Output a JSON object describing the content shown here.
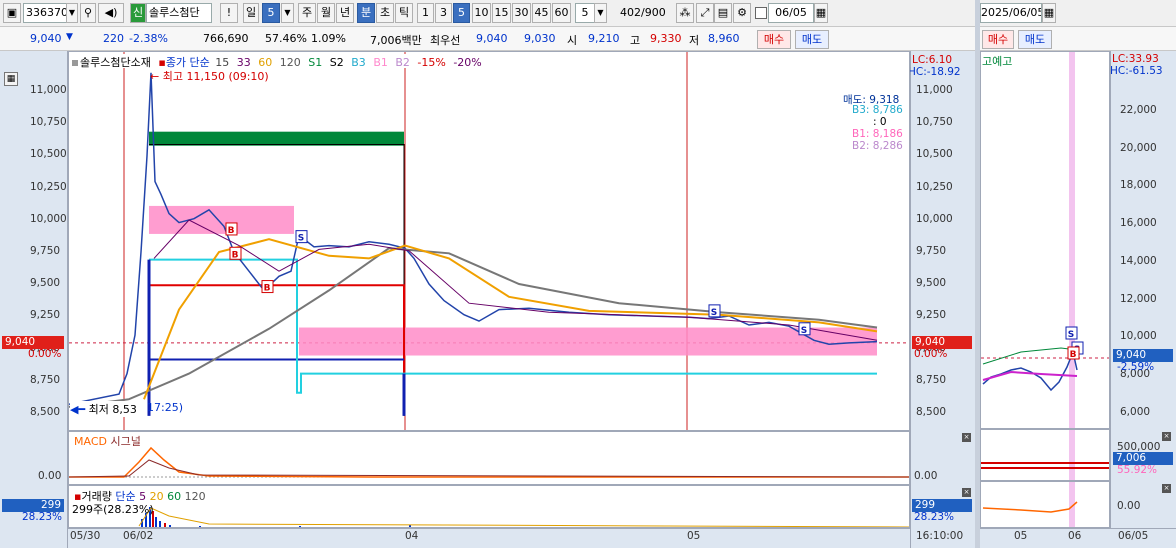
{
  "toolbar": {
    "code": "336370",
    "badge": "신",
    "name": "솔루스첨단",
    "warn": "!",
    "period": "일",
    "period_count": "5",
    "periods": [
      "주",
      "월",
      "년",
      "분",
      "초",
      "틱"
    ],
    "intervals": [
      "1",
      "3",
      "5",
      "10",
      "15",
      "30",
      "45",
      "60"
    ],
    "selected_interval": "5",
    "unit_value": "5",
    "count": "402",
    "count_total": "/900",
    "date": "06/05"
  },
  "quote": {
    "price": "9,040",
    "change": "220",
    "change_pct": "-2.38%",
    "volume": "766,690",
    "vol_ratio": "57.46%",
    "turnover_ratio": "1.09%",
    "amount": "7,006백만",
    "best_label": "최우선",
    "ask1": "9,040",
    "bid1": "9,030",
    "open_label": "시",
    "open": "9,210",
    "high_label": "고",
    "high": "9,330",
    "low_label": "저",
    "low": "8,960",
    "buy": "매수",
    "sell": "매도"
  },
  "main_chart": {
    "legend": {
      "name": "솔루스첨단소재",
      "close_label": "종가 단순",
      "ma": [
        "15",
        "33",
        "60",
        "120",
        "S1",
        "S2",
        "B3",
        "B1",
        "B2",
        "-15%",
        "-20%"
      ]
    },
    "lc": "LC:6.10",
    "hc": "HC:-18.92",
    "high_marker": "최고 11,150 (09:10)",
    "low_marker": "최저 8,53",
    "low_marker_time": "17:25)",
    "yticks": [
      "11,000",
      "10,750",
      "10,500",
      "10,250",
      "10,000",
      "9,750",
      "9,500",
      "9,250",
      "9,000",
      "8,750",
      "8,500"
    ],
    "price_box": "9,040",
    "pct_box": "0.00%",
    "sell_line": "매도: 9,318",
    "b3_line": "B3: 8,786",
    "zero_line": ": 0",
    "b1_line": "B1: 8,186",
    "b2_line": "B2: 8,286",
    "signal_S": "S",
    "signal_B": "B"
  },
  "macd": {
    "label1": "MACD",
    "label2": "시그널",
    "ytick": "0.00"
  },
  "volume_panel": {
    "label": "거래량",
    "ma_label": "단순",
    "ma": [
      "5",
      "20",
      "60",
      "120"
    ],
    "info": "299주(28.23%)",
    "vol_box": "299",
    "pct_box": "28.23%"
  },
  "xaxis": {
    "labels": [
      "05/30",
      "06/02",
      "04",
      "05"
    ],
    "time": "16:10:00"
  },
  "right_panel": {
    "date": "2025/06/05",
    "buy": "매수",
    "sell": "매도",
    "legend": "고예고",
    "lc": "LC:33.93",
    "hc": "HC:-61.53",
    "yticks": [
      "22,000",
      "20,000",
      "18,000",
      "16,000",
      "14,000",
      "12,000",
      "10,000",
      "8,000",
      "6,000"
    ],
    "price_box": "9,040",
    "pct": "-2.59%",
    "vol_tick": "500,000",
    "vol_box": "7,006",
    "vol_pct": "55.92%",
    "macd_tick": "0.00",
    "xlabels": [
      "05",
      "06",
      "06/05"
    ]
  },
  "colors": {
    "up": "#d40000",
    "down": "#0033cc",
    "pink": "#ff8cc8",
    "green": "#00883a",
    "accent": "#3a6fbf"
  }
}
